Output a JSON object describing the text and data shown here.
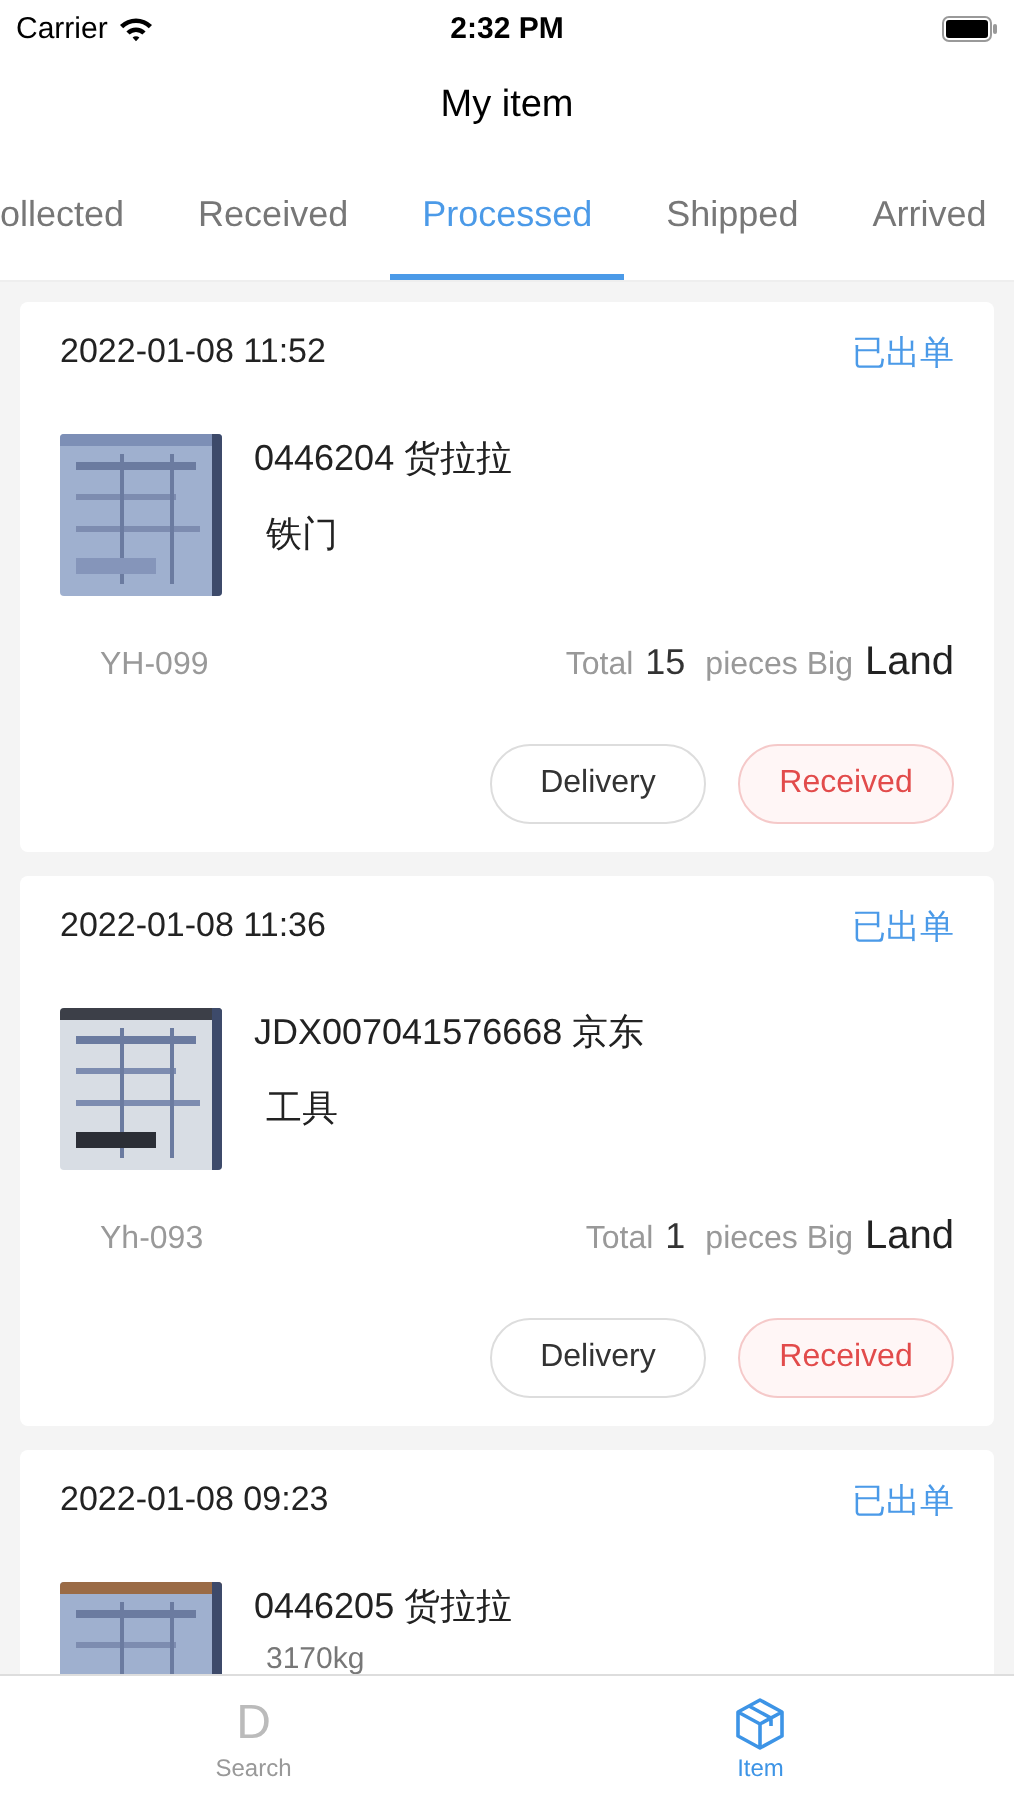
{
  "status_bar": {
    "carrier": "Carrier",
    "time": "2:32 PM"
  },
  "header": {
    "title": "My item"
  },
  "tabs": [
    {
      "label": "ollected",
      "selected": false
    },
    {
      "label": "Received",
      "selected": false
    },
    {
      "label": "Processed",
      "selected": true
    },
    {
      "label": "Shipped",
      "selected": false
    },
    {
      "label": "Arrived",
      "selected": false
    }
  ],
  "orders": [
    {
      "datetime": "2022-01-08 11:52",
      "status": "已出单",
      "title": "0446204 货拉拉",
      "subtitle": "铁门",
      "code": "YH-099",
      "total_label": "Total",
      "count": "15",
      "unit": "pieces Big",
      "mode": "Land",
      "buttons": [
        {
          "label": "Delivery",
          "kind": "plain"
        },
        {
          "label": "Received",
          "kind": "danger"
        }
      ]
    },
    {
      "datetime": "2022-01-08 11:36",
      "status": "已出单",
      "title": "JDX007041576668 京东",
      "subtitle": "工具",
      "code": "Yh-093",
      "total_label": "Total",
      "count": "1",
      "unit": "pieces Big",
      "mode": "Land",
      "buttons": [
        {
          "label": "Delivery",
          "kind": "plain"
        },
        {
          "label": "Received",
          "kind": "danger"
        }
      ]
    },
    {
      "datetime": "2022-01-08 09:23",
      "status": "已出单",
      "title": "0446205 货拉拉",
      "subtitle": "3170kg"
    }
  ],
  "bottom_nav": [
    {
      "label": "Search",
      "icon_glyph": "D",
      "selected": false
    },
    {
      "label": "Item",
      "selected": true
    }
  ]
}
